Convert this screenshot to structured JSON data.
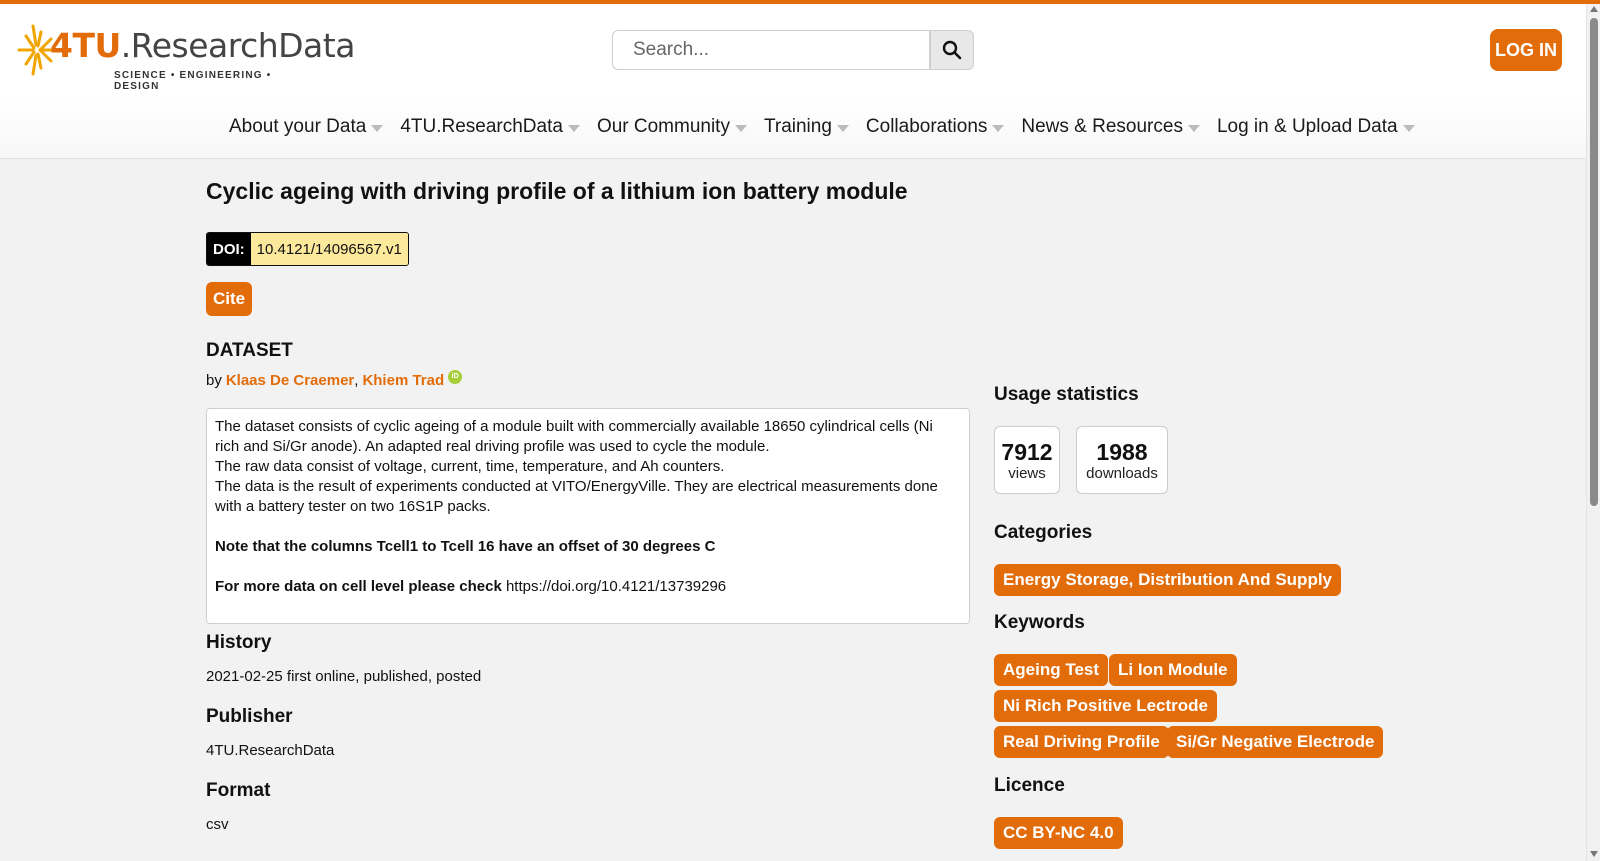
{
  "brand": {
    "logo_accent": "4TU",
    "logo_rest": ".ResearchData",
    "tagline": "SCIENCE • ENGINEERING • DESIGN",
    "accent_color": "#e36c0a"
  },
  "search": {
    "placeholder": "Search...",
    "icon": "search-icon"
  },
  "header": {
    "login_label": "LOG IN"
  },
  "nav": {
    "items": [
      {
        "label": "About your Data"
      },
      {
        "label": "4TU.ResearchData"
      },
      {
        "label": "Our Community"
      },
      {
        "label": "Training"
      },
      {
        "label": "Collaborations"
      },
      {
        "label": "News & Resources"
      },
      {
        "label": "Log in & Upload Data"
      }
    ]
  },
  "dataset": {
    "title": "Cyclic ageing with driving profile of a lithium ion battery module",
    "doi_label": "DOI:",
    "doi_value": "10.4121/14096567.v1",
    "cite_label": "Cite",
    "type_label": "DATASET",
    "by_prefix": "by",
    "authors": [
      {
        "name": "Klaas De Craemer",
        "separator": ","
      },
      {
        "name": "Khiem Trad",
        "orcid": "iD"
      }
    ],
    "description": {
      "lines": [
        "The dataset consists of cyclic ageing of a module built with commercially available 18650 cylindrical cells (Ni rich and Si/Gr anode). An adapted real driving profile was used to cycle the module.",
        "The raw data consist of voltage, current, time, temperature, and Ah counters.",
        "The data is the result of experiments conducted at VITO/EnergyVille. They are electrical measurements done with a battery tester on two 16S1P packs."
      ],
      "note": "Note that the columns Tcell1 to Tcell 16 have an offset of 30 degrees C",
      "more_prefix": "For more data on cell level please check",
      "more_link": "https://doi.org/10.4121/13739296"
    },
    "history": {
      "heading": "History",
      "value": "2021-02-25 first online, published, posted"
    },
    "publisher": {
      "heading": "Publisher",
      "value": "4TU.ResearchData"
    },
    "format": {
      "heading": "Format",
      "value": "csv"
    }
  },
  "sidebar": {
    "usage": {
      "heading": "Usage statistics",
      "views": "7912",
      "views_label": "views",
      "downloads": "1988",
      "downloads_label": "downloads"
    },
    "categories": {
      "heading": "Categories",
      "items": [
        "Energy Storage, Distribution And Supply"
      ]
    },
    "keywords": {
      "heading": "Keywords",
      "items": [
        "Ageing Test",
        "Li Ion Module",
        "Ni Rich Positive Lectrode",
        "Real Driving Profile",
        "Si/Gr Negative Electrode"
      ]
    },
    "licence": {
      "heading": "Licence",
      "value": "CC BY-NC 4.0"
    }
  }
}
